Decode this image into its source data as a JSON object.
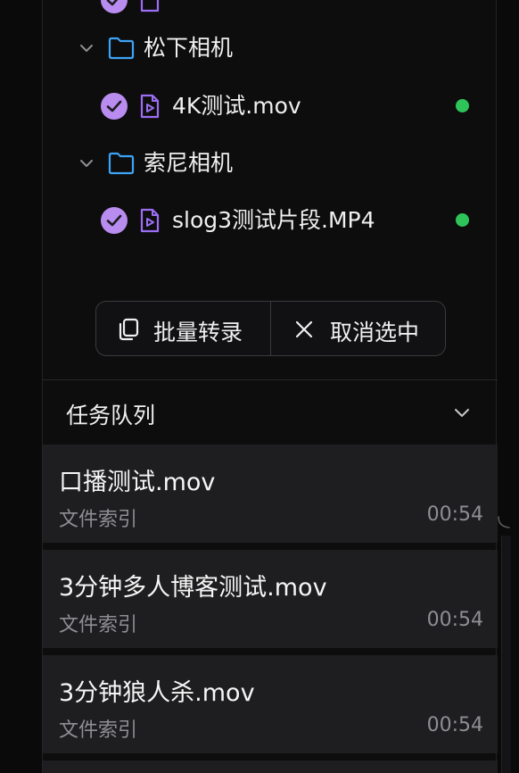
{
  "file_tree": {
    "items": [
      {
        "type": "folder",
        "label": "松下相机"
      },
      {
        "type": "file",
        "label": "4K测试.mov",
        "selected": true,
        "status_color": "#2fc45a"
      },
      {
        "type": "folder",
        "label": "索尼相机"
      },
      {
        "type": "file",
        "label": "slog3测试片段.MP4",
        "selected": true,
        "status_color": "#2fc45a"
      }
    ]
  },
  "actions": {
    "batch_transcribe_label": "批量转录",
    "cancel_selection_label": "取消选中"
  },
  "queue": {
    "title": "任务队列",
    "tasks": [
      {
        "name": "口播测试.mov",
        "status": "文件索引",
        "time": "00:54"
      },
      {
        "name": "3分钟多人博客测试.mov",
        "status": "文件索引",
        "time": "00:54"
      },
      {
        "name": "3分钟狼人杀.mov",
        "status": "文件索引",
        "time": "00:54"
      }
    ]
  },
  "colors": {
    "accent": "#b98cf0",
    "accent_dark": "#8b5cf6",
    "folder": "#3ea3f5",
    "status_ok": "#2fc45a",
    "card_bg": "#1e1e20"
  },
  "icons": {
    "folder": "folder-icon",
    "file": "video-file-icon",
    "check": "check-circle-icon",
    "chevron": "chevron-down-icon",
    "copy": "copy-icon",
    "close": "close-icon"
  }
}
